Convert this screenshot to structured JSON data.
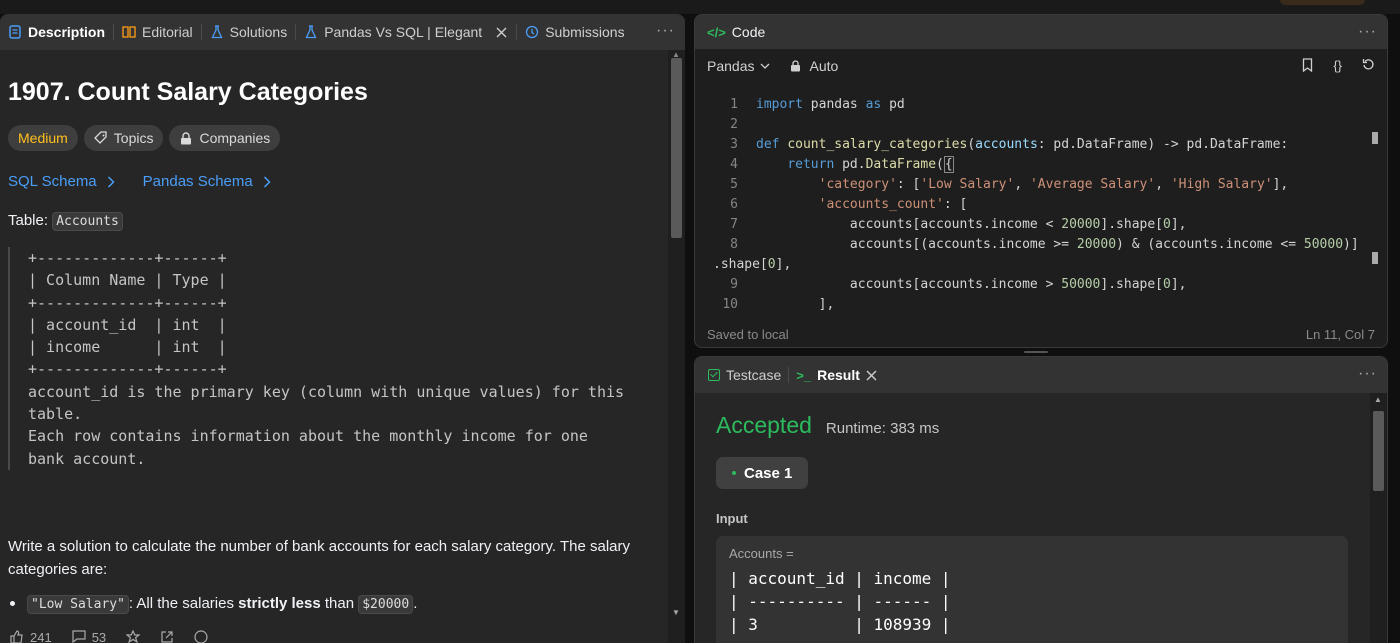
{
  "left": {
    "tabs": [
      {
        "label": "Description",
        "icon": "description-icon",
        "active": true
      },
      {
        "label": "Editorial",
        "icon": "book-icon"
      },
      {
        "label": "Solutions",
        "icon": "flask-icon"
      },
      {
        "label": "Pandas Vs SQL | Elegant",
        "icon": "flask-icon",
        "closable": true
      },
      {
        "label": "Submissions",
        "icon": "history-icon"
      }
    ],
    "more": "···",
    "title": "1907. Count Salary Categories",
    "chips": {
      "difficulty": "Medium",
      "topics": "Topics",
      "companies": "Companies"
    },
    "schemas": {
      "sql": "SQL Schema",
      "pandas": "Pandas Schema"
    },
    "table_prefix": "Table: ",
    "table_name": "Accounts",
    "schema_block": "+-------------+------+\n| Column Name | Type |\n+-------------+------+\n| account_id  | int  |\n| income      | int  |\n+-------------+------+\naccount_id is the primary key (column with unique values) for this\ntable.\nEach row contains information about the monthly income for one\nbank account.",
    "paragraph": "Write a solution to calculate the number of bank accounts for each salary category. The salary categories are:",
    "bullet": {
      "code1": "\"Low Salary\"",
      "text1": ": All the salaries ",
      "bold": "strictly less",
      "text2": " than ",
      "code2": "$20000",
      "text3": "."
    },
    "footer": {
      "likes": "241",
      "comments": "53"
    }
  },
  "code_panel": {
    "title": "Code",
    "title_icon": "code-icon",
    "language": "Pandas",
    "mode": "Auto",
    "status_left": "Saved to local",
    "status_right": "Ln 11, Col 7"
  },
  "result_panel": {
    "tabs": [
      {
        "label": "Testcase"
      },
      {
        "label": "Result",
        "active": true
      }
    ],
    "status": "Accepted",
    "runtime": "Runtime: 383 ms",
    "case_label": "Case 1",
    "input_label": "Input",
    "input_var": "Accounts =",
    "input_table": "| account_id | income |\n| ---------- | ------ |\n| 3          | 108939 |"
  },
  "colors": {
    "accent_green": "#2cbb5d",
    "medium_yellow": "#ffc01e",
    "link_blue": "#4a9ef8"
  }
}
